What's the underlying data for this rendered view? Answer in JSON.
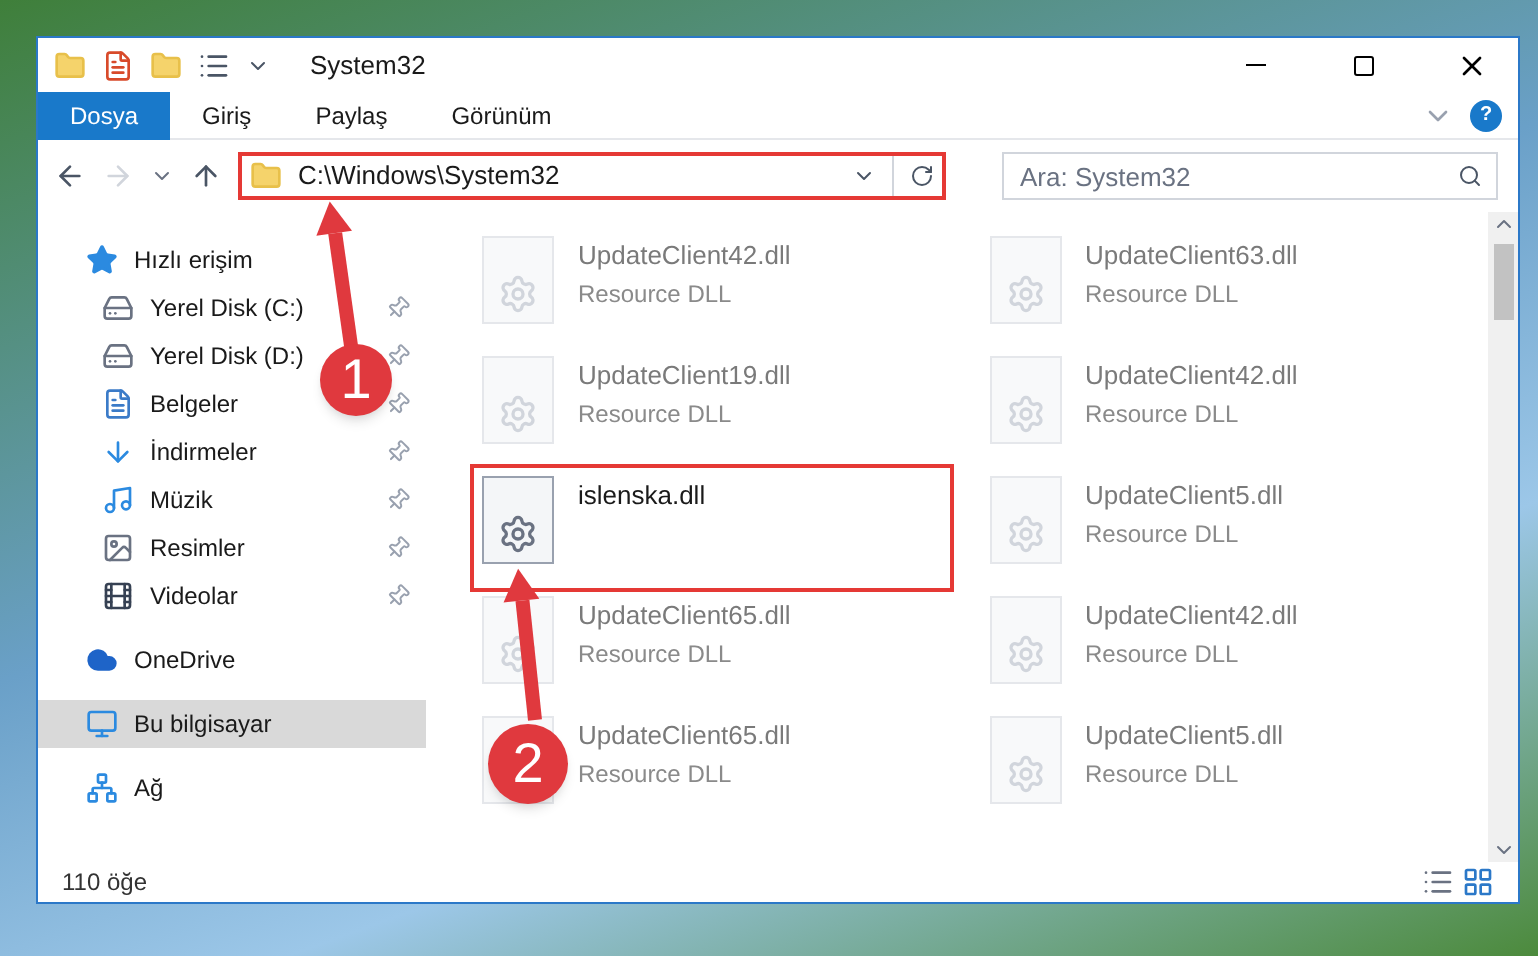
{
  "window": {
    "title": "System32"
  },
  "ribbon_tabs": [
    {
      "label": "Dosya",
      "selected": true
    },
    {
      "label": "Giriş",
      "selected": false
    },
    {
      "label": "Paylaş",
      "selected": false
    },
    {
      "label": "Görünüm",
      "selected": false
    }
  ],
  "help_button": {
    "label": "?"
  },
  "address": {
    "path": "C:\\Windows\\System32",
    "highlighted": true
  },
  "search": {
    "placeholder": "Ara: System32"
  },
  "sidebar": [
    {
      "label": "Hızlı erişim",
      "selected": false,
      "children": [
        {
          "label": "Yerel Disk (C:)"
        },
        {
          "label": "Yerel Disk (D:)"
        },
        {
          "label": "Belgeler"
        },
        {
          "label": "İndirmeler"
        },
        {
          "label": "Müzik"
        },
        {
          "label": "Resimler"
        },
        {
          "label": "Videolar"
        }
      ]
    },
    {
      "label": "OneDrive",
      "selected": false
    },
    {
      "label": "Bu bilgisayar",
      "selected": true
    },
    {
      "label": "Ağ",
      "selected": false
    }
  ],
  "files": [
    {
      "name": "UpdateClient42.dll",
      "type": "Resource DLL",
      "blurred": true,
      "highlighted": false
    },
    {
      "name": "UpdateClient63.dll",
      "type": "Resource DLL",
      "blurred": true,
      "highlighted": false
    },
    {
      "name": "UpdateClient19.dll",
      "type": "Resource DLL",
      "blurred": true,
      "highlighted": false
    },
    {
      "name": "UpdateClient42.dll",
      "type": "Resource DLL",
      "blurred": true,
      "highlighted": false
    },
    {
      "name": "islenska.dll",
      "blurred": false,
      "highlighted": true
    },
    {
      "name": "UpdateClient5.dll",
      "type": "Resource DLL",
      "blurred": true,
      "highlighted": false
    },
    {
      "name": "UpdateClient65.dll",
      "type": "Resource DLL",
      "blurred": true,
      "highlighted": false
    },
    {
      "name": "UpdateClient42.dll",
      "type": "Resource DLL",
      "blurred": true,
      "highlighted": false
    },
    {
      "name": "UpdateClient65.dll",
      "type": "Resource DLL",
      "blurred": true,
      "highlighted": false
    },
    {
      "name": "UpdateClient5.dll",
      "type": "Resource DLL",
      "blurred": true,
      "highlighted": false
    }
  ],
  "status_bar": {
    "item_count": "110 öğe"
  },
  "annotations": [
    {
      "label": "1"
    },
    {
      "label": "2"
    }
  ]
}
